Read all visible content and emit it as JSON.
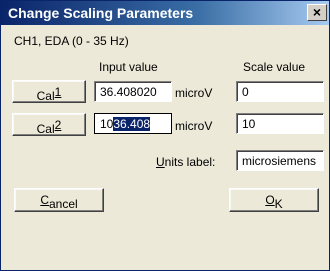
{
  "window": {
    "title": "Change Scaling Parameters",
    "close_symbol": "×"
  },
  "channel_label": "CH1, EDA (0 - 35 Hz)",
  "columns": {
    "input": "Input value",
    "scale": "Scale value"
  },
  "rows": [
    {
      "cal_prefix": "Cal",
      "cal_key": "1",
      "input_value": "36.408020",
      "unit": "microV",
      "scale_value": "0"
    },
    {
      "cal_prefix": "Cal",
      "cal_key": "2",
      "input_before": "10",
      "input_selected": "36.408",
      "unit": "microV",
      "scale_value": "10"
    }
  ],
  "units": {
    "label_key": "U",
    "label_rest": "nits label:",
    "value": "microsiemens"
  },
  "buttons": {
    "cancel_key": "C",
    "cancel_rest": "ancel",
    "ok_key": "O",
    "ok_rest": "K"
  }
}
